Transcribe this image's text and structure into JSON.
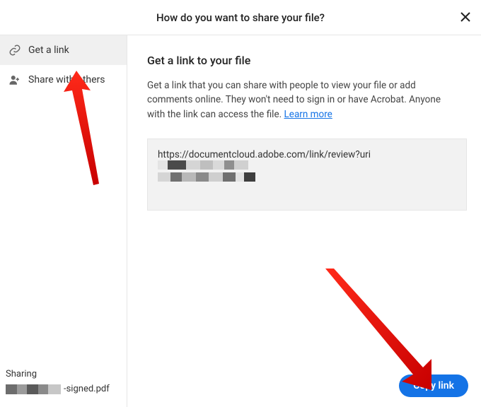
{
  "header": {
    "title": "How do you want to share your file?"
  },
  "sidebar": {
    "items": [
      {
        "label": "Get a link",
        "active": true
      },
      {
        "label": "Share with others",
        "active": false
      }
    ],
    "footer": {
      "sharing_label": "Sharing",
      "file_suffix": "-signed.pdf"
    }
  },
  "main": {
    "title": "Get a link to your file",
    "description_prefix": "Get a link that you can share with people to view your file or add comments online. They won't need to sign in or have Acrobat. Anyone with the link can access the file. ",
    "learn_more": "Learn more",
    "link_url_visible": "https://documentcloud.adobe.com/link/review?uri",
    "copy_button": "Copy link"
  },
  "colors": {
    "primary": "#1473e6"
  }
}
